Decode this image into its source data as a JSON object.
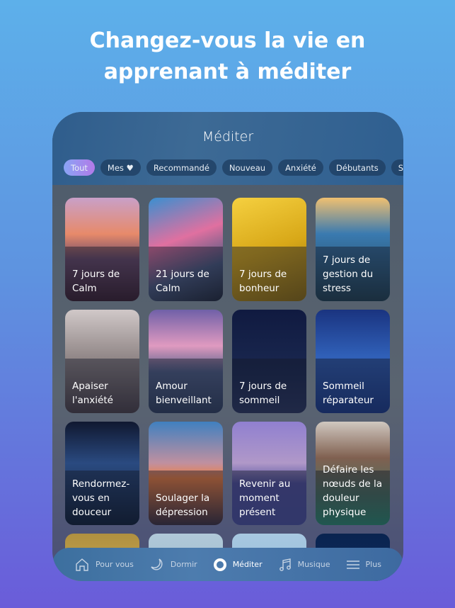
{
  "headline": "Changez-vous la vie en apprenant à méditer",
  "screen": {
    "title": "Méditer",
    "chips": [
      {
        "label": "Tout",
        "active": true
      },
      {
        "label": "Mes ♥"
      },
      {
        "label": "Recommandé"
      },
      {
        "label": "Nouveau"
      },
      {
        "label": "Anxiété"
      },
      {
        "label": "Débutants"
      },
      {
        "label": "Stress"
      }
    ],
    "cards": [
      {
        "label": "7 jours de Calm",
        "bg": "linear-gradient(180deg,#c9a0c8 0%,#e78a6a 35%,#6a4a6a 60%,#3a2030 100%)"
      },
      {
        "label": "21 jours de Calm",
        "bg": "linear-gradient(160deg,#3a8fd0 0%,#e070a0 40%,#4a5a80 70%,#202838 100%)"
      },
      {
        "label": "7 jours de bonheur",
        "bg": "linear-gradient(160deg,#f5d040 0%,#d8a818 50%,#8a6a10 100%)"
      },
      {
        "label": "7 jours de gestion du stress",
        "bg": "linear-gradient(180deg,#f0c070 0%,#3a7ab0 35%,#204050 100%)"
      },
      {
        "label": "Apaiser l'anxiété",
        "bg": "linear-gradient(180deg,#d0c8c8 0%,#9a9090 40%,#4a4048 100%)"
      },
      {
        "label": "Amour bienveillant",
        "bg": "linear-gradient(180deg,#7060a8 0%,#e09ac0 35%,#506088 60%,#304060 100%)"
      },
      {
        "label": "7 jours de sommeil",
        "bg": "linear-gradient(180deg,#101a40 0%,#1a2850 60%,#2a3660 100%)"
      },
      {
        "label": "Sommeil réparateur",
        "bg": "linear-gradient(180deg,#1a3480 0%,#3060b8 45%,#1a3a8a 100%)"
      },
      {
        "label": "Rendormez-vous en douceur",
        "bg": "linear-gradient(180deg,#101830 0%,#2a4a80 40%,#102038 100%)"
      },
      {
        "label": "Soulager la dépression",
        "bg": "linear-gradient(180deg,#4080c0 0%,#c090a0 40%,#f08040 55%,#3a3040 100%)"
      },
      {
        "label": "Revenir au moment présent",
        "bg": "linear-gradient(180deg,#9080d0 0%,#b098c8 40%,#5050a0 60%,#4a50a0 100%)"
      },
      {
        "label": "Défaire les nœuds de la douleur physique",
        "bg": "linear-gradient(180deg,#d0c8c0 0%,#806050 35%,#4a7060 70%,#2a8a70 100%)"
      },
      {
        "label": "",
        "bg": "linear-gradient(180deg,#b09040,#e0c060)"
      },
      {
        "label": "",
        "bg": "linear-gradient(180deg,#b0c8d8,#90b0c8)"
      },
      {
        "label": "",
        "bg": "linear-gradient(180deg,#a8c8e0,#80b0d8)"
      },
      {
        "label": "",
        "bg": "linear-gradient(180deg,#0a2450,#10306a)"
      }
    ]
  },
  "nav": [
    {
      "label": "Pour vous",
      "icon": "home-icon"
    },
    {
      "label": "Dormir",
      "icon": "moon-icon"
    },
    {
      "label": "Méditer",
      "icon": "circle-icon",
      "active": true
    },
    {
      "label": "Musique",
      "icon": "music-note-icon"
    },
    {
      "label": "Plus",
      "icon": "menu-icon"
    }
  ]
}
